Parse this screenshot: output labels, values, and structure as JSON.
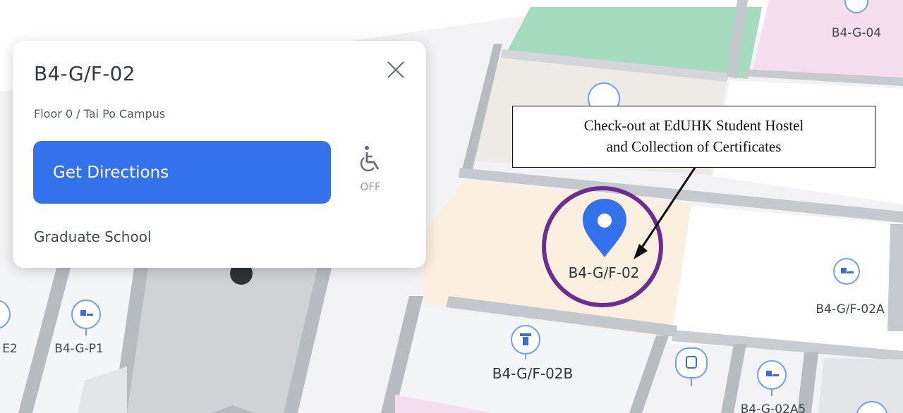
{
  "map": {
    "markers": [
      {
        "label": "B4-G-04",
        "icon": "location-pin-icon"
      },
      {
        "label": "B4-G/F-02",
        "icon": "selected-location-pin-icon"
      },
      {
        "label": "B4-G/F-02A",
        "icon": "classroom-icon"
      },
      {
        "label": "B4-G/F-02B",
        "icon": "reception-desk-icon"
      },
      {
        "label": "B4-G-P1",
        "icon": "classroom-icon"
      },
      {
        "label": "B4-G-02A5",
        "icon": "classroom-icon"
      },
      {
        "label": "E2",
        "icon": "classroom-icon"
      }
    ],
    "colors": {
      "selected_room": "#fbefdf",
      "green_room": "#a5dcbf",
      "pink_room": "#f5dfef",
      "grey_room": "#eeebe6",
      "pin": "#3471ec",
      "highlight_circle": "#6b2d8f"
    }
  },
  "card": {
    "title": "B4-G/F-02",
    "subtitle": "Floor 0 / Tai Po Campus",
    "directions_button": "Get Directions",
    "accessibility_status": "OFF",
    "department": "Graduate School"
  },
  "annotation": {
    "line1": "Check-out at EdUHK Student Hostel",
    "line2": "and Collection of Certificates"
  }
}
